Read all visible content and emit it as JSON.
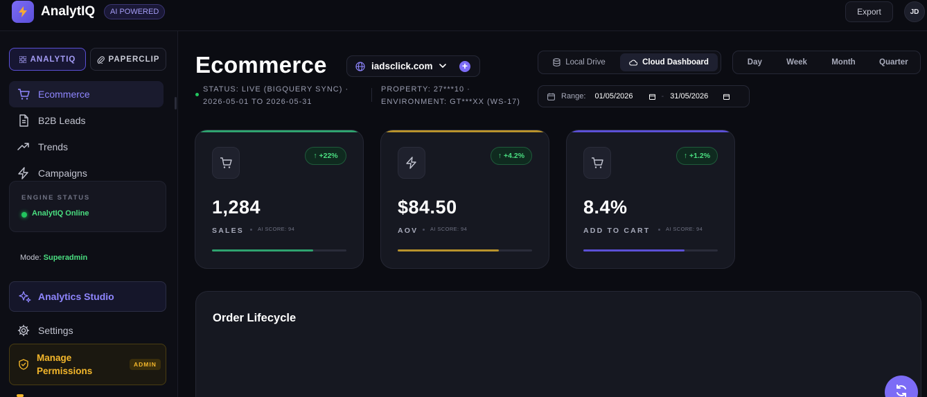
{
  "app": {
    "title": "AnalytIQ",
    "badge": "AI POWERED"
  },
  "header": {
    "export_label": "Export",
    "avatar_initials": "JD"
  },
  "sidebar": {
    "tabs": [
      {
        "label": "ANALYTIQ",
        "icon": "grid-icon",
        "active": true
      },
      {
        "label": "PAPERCLIP",
        "icon": "paperclip-icon",
        "active": false
      }
    ],
    "items": [
      {
        "label": "Ecommerce",
        "icon": "cart-icon",
        "active": true
      },
      {
        "label": "B2B Leads",
        "icon": "document-icon",
        "active": false
      },
      {
        "label": "Trends",
        "icon": "trending-up-icon",
        "active": false
      },
      {
        "label": "Campaigns",
        "icon": "bolt-icon",
        "active": false
      }
    ],
    "engine": {
      "label": "ENGINE STATUS",
      "status": "AnalytIQ Online"
    },
    "mode": {
      "label": "Mode:",
      "value": "Superadmin"
    },
    "studio_label": "Analytics Studio",
    "settings_label": "Settings",
    "manage": {
      "label": "Manage Permissions",
      "badge": "ADMIN"
    }
  },
  "main": {
    "title": "Ecommerce",
    "domain": "iadsclick.com",
    "status_line1": "STATUS: LIVE (BIGQUERY SYNC) ·",
    "status_line2": "2026-05-01 TO 2026-05-31",
    "property_line1": "PROPERTY: 27***10 ·",
    "property_line2": "ENVIRONMENT: GT***XX (WS-17)",
    "source_toggle": [
      {
        "label": "Local Drive",
        "icon": "database-icon",
        "active": false
      },
      {
        "label": "Cloud Dashboard",
        "icon": "cloud-icon",
        "active": true
      }
    ],
    "periods": [
      "Day",
      "Week",
      "Month",
      "Quarter"
    ],
    "range": {
      "label": "Range:",
      "from": "01/05/2026",
      "separator": "-",
      "to": "31/05/2026"
    }
  },
  "kpis": [
    {
      "value": "1,284",
      "label": "SALES",
      "delta": "↑ +22%",
      "score": "AI SCORE: 94",
      "icon": "cart-icon",
      "accent": "#2fa36f",
      "progress": 0.75
    },
    {
      "value": "$84.50",
      "label": "AOV",
      "delta": "↑ +4.2%",
      "score": "AI SCORE: 94",
      "icon": "bolt-icon",
      "accent": "#b8932c",
      "progress": 0.75
    },
    {
      "value": "8.4%",
      "label": "ADD TO CART",
      "delta": "↑ +1.2%",
      "score": "AI SCORE: 94",
      "icon": "cart-icon",
      "accent": "#5b50d6",
      "progress": 0.75
    }
  ],
  "lifecycle": {
    "title": "Order Lifecycle"
  },
  "colors": {
    "accent": "#7c6cf6",
    "success": "#4ade80",
    "warning": "#f4b72b",
    "background": "#0b0c12"
  }
}
